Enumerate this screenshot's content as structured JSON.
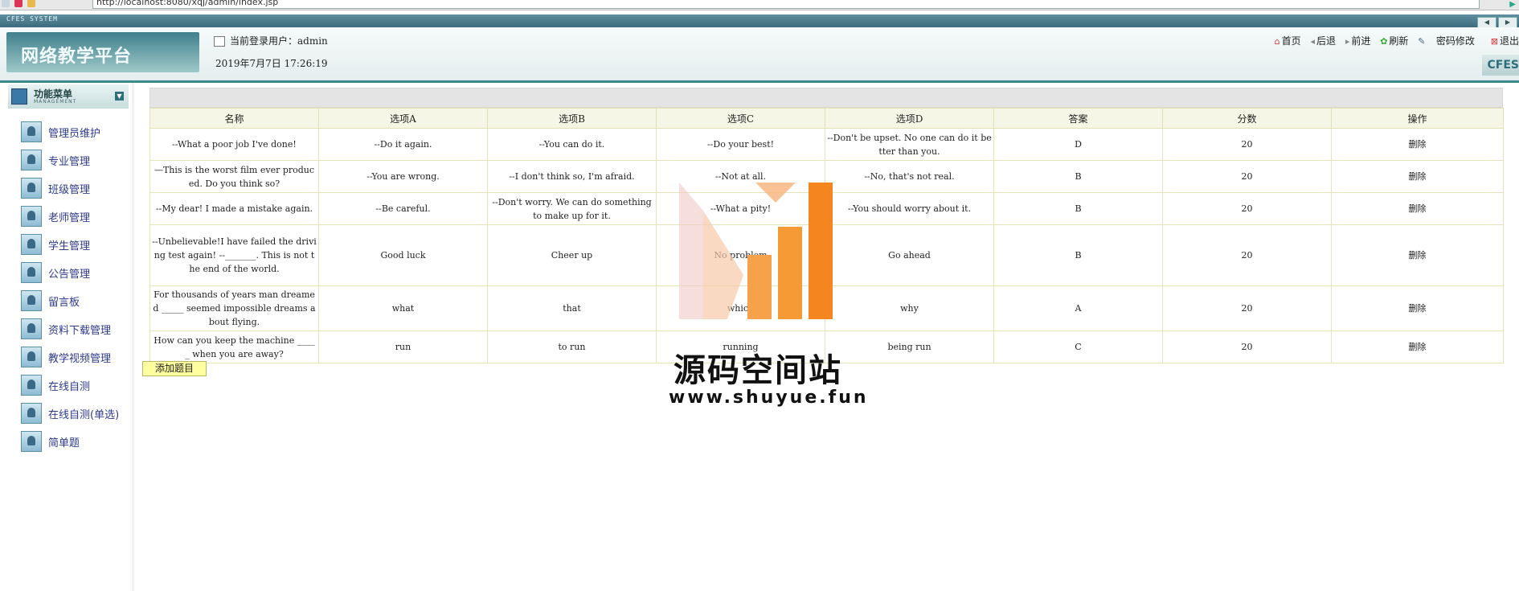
{
  "browser": {
    "url": "http://localhost:8080/xqj/admin/index.jsp",
    "right_label": "▶"
  },
  "system_bar": {
    "title": "CFES SYSTEM",
    "btn_prev": "◀",
    "btn_next": "▶"
  },
  "header": {
    "platform_title": "网络教学平台",
    "current_user": "当前登录用户：admin",
    "datetime": "2019年7月7日 17:26:19",
    "nav": [
      {
        "icon": "home-icon",
        "label": "首页"
      },
      {
        "icon": "back-icon",
        "label": "后退"
      },
      {
        "icon": "forward-icon",
        "label": "前进"
      },
      {
        "icon": "refresh-icon",
        "label": "刷新"
      },
      {
        "icon": "key-icon",
        "label": "密码修改"
      },
      {
        "icon": "exit-icon",
        "label": "退出"
      }
    ],
    "cfes": "CFES"
  },
  "menu": {
    "title": "功能菜单",
    "subtitle": "MANAGEMENT",
    "items": [
      "管理员维护",
      "专业管理",
      "班级管理",
      "老师管理",
      "学生管理",
      "公告管理",
      "留言板",
      "资料下载管理",
      "教学视频管理",
      "在线自测",
      "在线自测(单选)",
      "简单题"
    ]
  },
  "table": {
    "headers": [
      "名称",
      "选项A",
      "选项B",
      "选项C",
      "选项D",
      "答案",
      "分数",
      "操作"
    ],
    "rows": [
      [
        "--What a poor job I've done!",
        "--Do it again.",
        "--You can do it.",
        "--Do your best!",
        "--Don't be upset. No one can do it better than you.",
        "D",
        "20",
        "删除"
      ],
      [
        "—This is the worst film ever produced. Do you think so?",
        "--You are wrong.",
        "--I don't think so, I'm afraid.",
        "--Not at all.",
        "--No, that's not real.",
        "B",
        "20",
        "删除"
      ],
      [
        "--My dear! I made a mistake again.",
        "--Be careful.",
        "--Don't worry. We can do something to make up for it.",
        "--What a pity!",
        "--You should worry about it.",
        "B",
        "20",
        "删除"
      ],
      [
        "--Unbelievable!I have failed the driving test again! --_______. This is not the end of the world.",
        "Good luck",
        "Cheer up",
        "No problem",
        "Go ahead",
        "B",
        "20",
        "删除"
      ],
      [
        "For thousands of years man dreamed _____ seemed impossible dreams about flying.",
        "what",
        "that",
        "which",
        "why",
        "A",
        "20",
        "删除"
      ],
      [
        "How can you keep the machine _____ when you are away?",
        "run",
        "to run",
        "running",
        "being run",
        "C",
        "20",
        "删除"
      ]
    ]
  },
  "add_button": "添加题目",
  "watermark": {
    "line1": "源码空间站",
    "line2": "www.shuyue.fun"
  },
  "colors": {
    "accent": "#3b8a8a",
    "watermark_orange": "#f5851f",
    "table_header_bg": "#f6f6e6"
  }
}
